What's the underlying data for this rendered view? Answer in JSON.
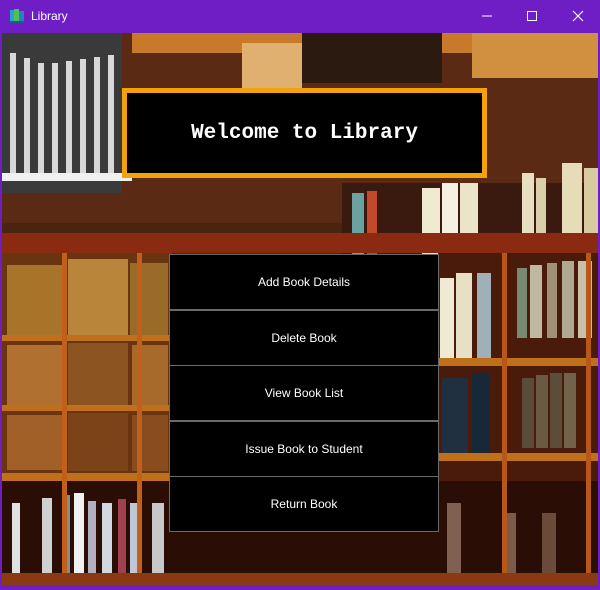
{
  "window": {
    "title": "Library",
    "icon": "books-icon",
    "controls": [
      "minimize-icon",
      "maximize-icon",
      "close-icon"
    ],
    "accent_color": "#6f1ec5"
  },
  "heading": {
    "text": "Welcome to Library",
    "border_color": "#f4a20c"
  },
  "menu": {
    "buttons": [
      {
        "label": "Add Book Details"
      },
      {
        "label": "Delete Book"
      },
      {
        "label": "View Book List"
      },
      {
        "label": "Issue Book to Student"
      },
      {
        "label": "Return Book"
      }
    ]
  },
  "background": {
    "description": "library-bookshelves-image"
  }
}
